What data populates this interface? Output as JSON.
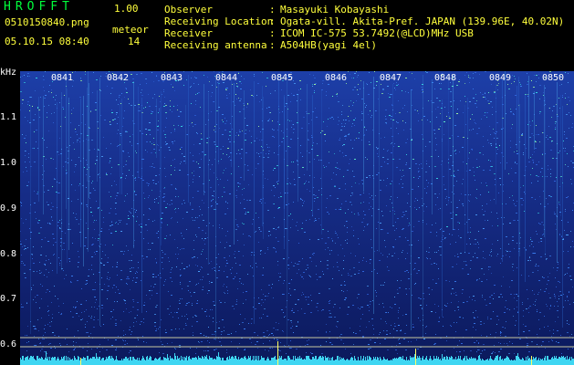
{
  "app": {
    "title": "HROFFT",
    "version": "1.00"
  },
  "file": {
    "name": "0510150840.png",
    "timestamp": "05.10.15 08:40"
  },
  "meteor": {
    "label": "meteor",
    "count": "14"
  },
  "info": [
    {
      "key": "Observer",
      "value": "Masayuki Kobayashi"
    },
    {
      "key": "Receiving Location",
      "value": "Ogata-vill. Akita-Pref. JAPAN (139.96E, 40.02N)"
    },
    {
      "key": "Receiver",
      "value": "ICOM IC-575 53.7492(@LCD)MHz USB"
    },
    {
      "key": "Receiving antenna",
      "value": "A504HB(yagi 4el)"
    }
  ],
  "yaxis": {
    "unit": "kHz",
    "ticks": [
      "1.1",
      "1.0",
      "0.9",
      "0.8",
      "0.7",
      "0.6"
    ]
  },
  "time_labels": [
    "0841",
    "0842",
    "0843",
    "0844",
    "0845",
    "0846",
    "0847",
    "0848",
    "0849",
    "0850"
  ],
  "colors": {
    "label_green": "#00ff3c",
    "label_yellow": "#ffff3c",
    "background": "#000000"
  }
}
